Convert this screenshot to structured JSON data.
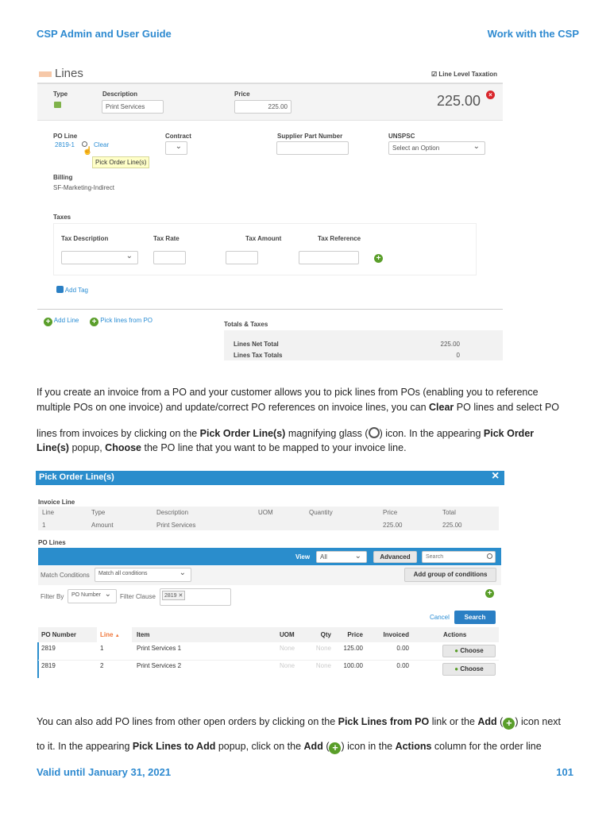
{
  "header": {
    "left": "CSP Admin and User Guide",
    "right": "Work with the CSP"
  },
  "lines_panel": {
    "title": "Lines",
    "line_level_taxation": "Line Level Taxation",
    "type_label": "Type",
    "description_label": "Description",
    "description_value": "Print Services",
    "price_label": "Price",
    "price_value": "225.00",
    "total": "225.00",
    "po_line_label": "PO Line",
    "po_line_value": "2819-1",
    "clear": "Clear",
    "tooltip": "Pick Order Line(s)",
    "contract_label": "Contract",
    "supplier_part_label": "Supplier Part Number",
    "unspsc_label": "UNSPSC",
    "unspsc_value": "Select an Option",
    "billing_label": "Billing",
    "billing_value": "SF-Marketing-Indirect",
    "taxes_label": "Taxes",
    "tax_description": "Tax Description",
    "tax_rate": "Tax Rate",
    "tax_amount": "Tax Amount",
    "tax_reference": "Tax Reference",
    "add_tag": "Add Tag",
    "add_line": "Add Line",
    "pick_lines": "Pick lines from PO",
    "totals_title": "Totals & Taxes",
    "lines_net_total_label": "Lines Net Total",
    "lines_net_total": "225.00",
    "lines_tax_totals_label": "Lines Tax Totals",
    "lines_tax_totals": "0"
  },
  "para1": {
    "l1": "If you create an invoice from a PO and your customer allows you to pick lines from POs (enabling you to reference",
    "l2a": "multiple POs on one invoice) and update/correct PO references on invoice lines, you can ",
    "l2b": "Clear",
    "l2c": " PO lines and select PO",
    "l3a": "lines from invoices by clicking on the ",
    "l3b": "Pick Order Line(s)",
    "l3c": " magnifying glass (",
    "l3d": ") icon. In the appearing ",
    "l3e": "Pick Order",
    "l4a": "Line(s)",
    "l4b": " popup, ",
    "l4c": "Choose",
    "l4d": " the PO line that you want to be mapped to your invoice line."
  },
  "pick_dialog": {
    "title": "Pick Order Line(s)",
    "invoice_line_label": "Invoice Line",
    "invoice_columns": [
      "Line",
      "Type",
      "Description",
      "UOM",
      "Quantity",
      "Price",
      "Total"
    ],
    "invoice_row": [
      "1",
      "Amount",
      "Print Services",
      "",
      "",
      "225.00",
      "225.00"
    ],
    "po_lines_label": "PO Lines",
    "view_label": "View",
    "view_value": "All",
    "advanced": "Advanced",
    "search_placeholder": "Search",
    "match_conditions_label": "Match Conditions",
    "match_value": "Match all conditions",
    "add_group": "Add group of conditions",
    "filter_by_label": "Filter By",
    "filter_by_value": "PO Number",
    "filter_clause_label": "Filter Clause",
    "filter_token": "2819",
    "cancel": "Cancel",
    "search": "Search",
    "columns": [
      "PO Number",
      "Line",
      "Item",
      "UOM",
      "Qty",
      "Price",
      "Invoiced",
      "Actions"
    ],
    "rows": [
      [
        "2819",
        "1",
        "Print Services 1",
        "None",
        "None",
        "125.00",
        "0.00"
      ],
      [
        "2819",
        "2",
        "Print Services 2",
        "None",
        "None",
        "100.00",
        "0.00"
      ]
    ],
    "choose": "Choose"
  },
  "para2": {
    "l1a": "You can also add PO lines from other open orders by clicking on the ",
    "l1b": "Pick Lines from PO",
    "l1c": " link or the ",
    "l1d": "Add",
    "l1e": " (",
    "l1f": ") icon next",
    "l2a": "to it. In the appearing ",
    "l2b": "Pick Lines to Add",
    "l2c": " popup, click on the ",
    "l2d": "Add",
    "l2e": " (",
    "l2f": ") icon in the ",
    "l2g": "Actions",
    "l2h": " column for the order line"
  },
  "footer": {
    "left": "Valid until January 31, 2021",
    "page": "101"
  },
  "colors": {
    "brand_blue": "#2e8ad0",
    "dialog_blue": "#2a8dcc",
    "green": "#5a9e2a"
  }
}
